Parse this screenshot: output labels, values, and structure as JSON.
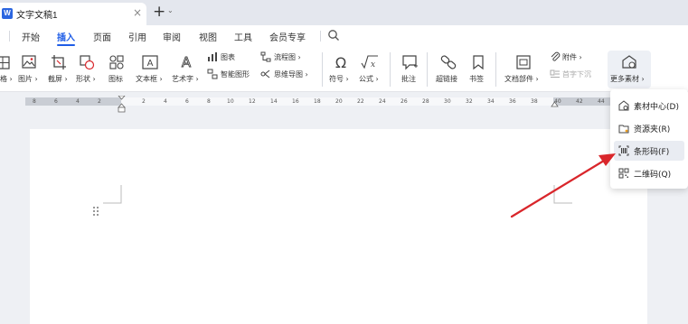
{
  "titlebar": {
    "doc_title": "文字文稿1",
    "app_logo_letter": "W",
    "close_glyph": "×",
    "new_tab_glyph": "+",
    "new_tab_caret": "⌄"
  },
  "ribbon_tabs": [
    {
      "label": "开始"
    },
    {
      "label": "插入",
      "active": true
    },
    {
      "label": "页面"
    },
    {
      "label": "引用"
    },
    {
      "label": "审阅"
    },
    {
      "label": "视图"
    },
    {
      "label": "工具"
    },
    {
      "label": "会员专享"
    }
  ],
  "toolbar": {
    "truncated_left": "格 ›",
    "picture": "图片 ›",
    "screenshot": "截屏 ›",
    "shapes": "形状 ›",
    "icons": "图标",
    "textbox": "文本框 ›",
    "wordart": "艺术字 ›",
    "chart": "图表",
    "smart_art": "智能图形",
    "flowchart": "流程图 ›",
    "mindmap": "思维导图 ›",
    "symbol": "符号 ›",
    "formula": "公式 ›",
    "comment": "批注",
    "hyperlink": "超链接",
    "bookmark": "书签",
    "doc_parts": "文档部件 ›",
    "attachment": "附件 ›",
    "drop_cap": "首字下沉",
    "more_materials": "更多素材 ›"
  },
  "ruler": {
    "labels": [
      "8",
      "6",
      "4",
      "2",
      "2",
      "4",
      "6",
      "8",
      "10",
      "12",
      "14",
      "16",
      "18",
      "20",
      "22",
      "24",
      "26",
      "28",
      "30",
      "32",
      "34",
      "36",
      "38",
      "40",
      "42",
      "44"
    ]
  },
  "dropdown": {
    "items": [
      {
        "label": "素材中心(D)",
        "icon": "material-center-icon"
      },
      {
        "label": "资源夹(R)",
        "icon": "resource-folder-icon"
      },
      {
        "label": "条形码(F)",
        "icon": "barcode-icon",
        "highlighted": true
      },
      {
        "label": "二维码(Q)",
        "icon": "qrcode-icon"
      }
    ]
  },
  "colors": {
    "accent": "#1e5ce6",
    "annotation_arrow": "#d9262b",
    "highlight": "#e9ecf2",
    "background": "#eef0f4"
  }
}
